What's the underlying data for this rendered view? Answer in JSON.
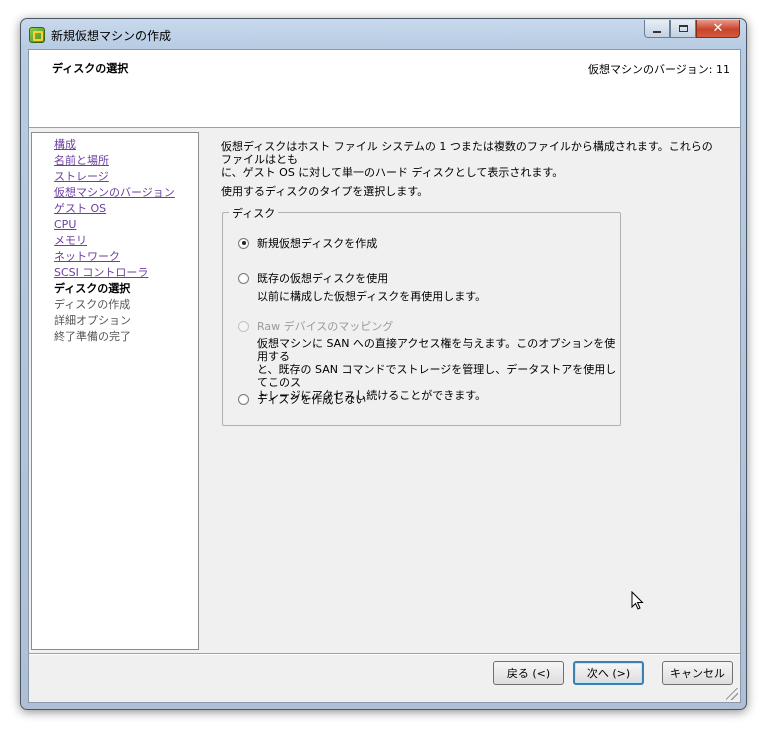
{
  "window": {
    "title": "新規仮想マシンの作成"
  },
  "header": {
    "title": "ディスクの選択",
    "version": "仮想マシンのバージョン: 11"
  },
  "steps": [
    {
      "label": "構成",
      "state": "link"
    },
    {
      "label": "名前と場所",
      "state": "link"
    },
    {
      "label": "ストレージ",
      "state": "link"
    },
    {
      "label": "仮想マシンのバージョン",
      "state": "link"
    },
    {
      "label": "ゲスト OS",
      "state": "link"
    },
    {
      "label": "CPU",
      "state": "link"
    },
    {
      "label": "メモリ",
      "state": "link"
    },
    {
      "label": "ネットワーク",
      "state": "link"
    },
    {
      "label": "SCSI コントローラ",
      "state": "link"
    },
    {
      "label": "ディスクの選択",
      "state": "current"
    },
    {
      "label": "ディスクの作成",
      "state": "future"
    },
    {
      "label": "詳細オプション",
      "state": "future"
    },
    {
      "label": "終了準備の完了",
      "state": "future"
    }
  ],
  "main": {
    "description_line1": "仮想ディスクはホスト ファイル システムの 1 つまたは複数のファイルから構成されます。これらのファイルはとも",
    "description_line2": "に、ゲスト OS に対して単一のハード ディスクとして表示されます。",
    "prompt": "使用するディスクのタイプを選択します。",
    "group_label": "ディスク",
    "options": [
      {
        "label": "新規仮想ディスクを作成",
        "checked": true,
        "disabled": false
      },
      {
        "label": "既存の仮想ディスクを使用",
        "checked": false,
        "disabled": false,
        "sub": [
          "以前に構成した仮想ディスクを再使用します。"
        ]
      },
      {
        "label": "Raw デバイスのマッピング",
        "checked": false,
        "disabled": true,
        "sub": [
          "仮想マシンに SAN への直接アクセス権を与えます。このオプションを使用する",
          "と、既存の SAN コマンドでストレージを管理し、データストアを使用してこのス",
          "トレージにアクセスし続けることができます。"
        ]
      },
      {
        "label": "ディスクを作成しない",
        "checked": false,
        "disabled": false
      }
    ]
  },
  "buttons": {
    "back": "戻る (<)",
    "next": "次へ (>)",
    "cancel": "キャンセル"
  },
  "colors": {
    "link": "#6b3fa0",
    "default_button_border": "#3c7fb1",
    "close_button": "#c7442c"
  }
}
